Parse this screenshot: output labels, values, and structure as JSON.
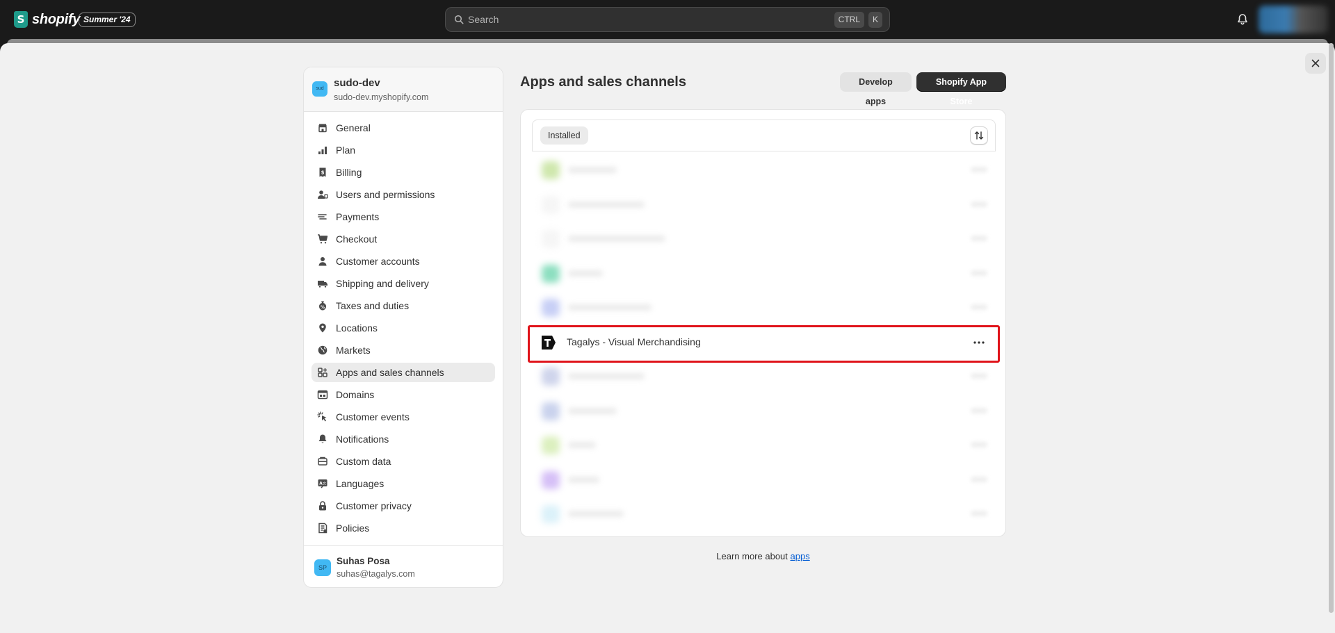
{
  "topbar": {
    "logo_text": "shopify",
    "logo_letter": "S",
    "edition_badge": "Summer '24",
    "search_placeholder": "Search",
    "shortcut_ctrl": "CTRL",
    "shortcut_k": "K"
  },
  "store": {
    "avatar": "sud",
    "name": "sudo-dev",
    "url": "sudo-dev.myshopify.com"
  },
  "sidebar": {
    "items": [
      {
        "label": "General",
        "icon": "store-icon"
      },
      {
        "label": "Plan",
        "icon": "plan-icon"
      },
      {
        "label": "Billing",
        "icon": "billing-icon"
      },
      {
        "label": "Users and permissions",
        "icon": "users-icon"
      },
      {
        "label": "Payments",
        "icon": "payments-icon"
      },
      {
        "label": "Checkout",
        "icon": "cart-icon"
      },
      {
        "label": "Customer accounts",
        "icon": "person-icon"
      },
      {
        "label": "Shipping and delivery",
        "icon": "truck-icon"
      },
      {
        "label": "Taxes and duties",
        "icon": "tax-icon"
      },
      {
        "label": "Locations",
        "icon": "location-icon"
      },
      {
        "label": "Markets",
        "icon": "globe-icon"
      },
      {
        "label": "Apps and sales channels",
        "icon": "apps-icon",
        "active": true
      },
      {
        "label": "Domains",
        "icon": "domains-icon"
      },
      {
        "label": "Customer events",
        "icon": "events-icon"
      },
      {
        "label": "Notifications",
        "icon": "bell-icon"
      },
      {
        "label": "Custom data",
        "icon": "database-icon"
      },
      {
        "label": "Languages",
        "icon": "language-icon"
      },
      {
        "label": "Customer privacy",
        "icon": "lock-icon"
      },
      {
        "label": "Policies",
        "icon": "policies-icon"
      }
    ]
  },
  "user": {
    "initials": "SP",
    "name": "Suhas Posa",
    "email": "suhas@tagalys.com"
  },
  "main": {
    "title": "Apps and sales channels",
    "develop_apps_label": "Develop apps",
    "app_store_label": "Shopify App Store",
    "filter_chip": "Installed",
    "visible_app": {
      "name": "Tagalys - Visual Merchandising",
      "logo_letter": "T"
    },
    "learn_more_prefix": "Learn more about",
    "learn_more_link": "apps"
  },
  "colors": {
    "highlight": "#e0141b",
    "link": "#005bd3",
    "brand": "#1f9b8b"
  }
}
